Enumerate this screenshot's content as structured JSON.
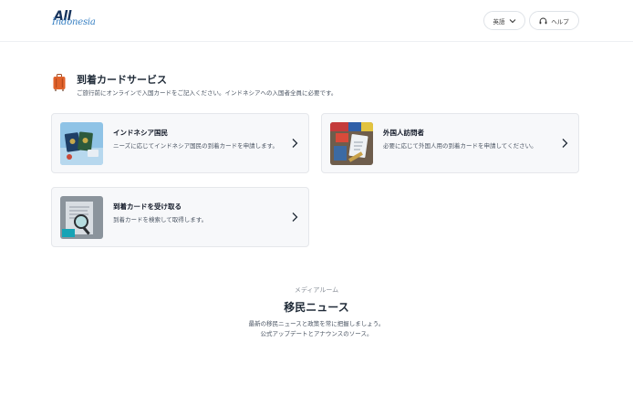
{
  "header": {
    "logo_main": "All",
    "logo_sub": "Indonesia",
    "language_label": "英語",
    "help_label": "ヘルプ"
  },
  "service": {
    "title": "到着カードサービス",
    "subtitle": "ご旅行前にオンラインで入国カードをご記入ください。インドネシアへの入国者全員に必要です。",
    "cards": [
      {
        "title": "インドネシア国民",
        "description": "ニーズに応じてインドネシア国民の到着カードを申請します。"
      },
      {
        "title": "外国人訪問者",
        "description": "必要に応じて外国人用の到着カードを申請してください。"
      },
      {
        "title": "到着カードを受け取る",
        "description": "到着カードを検索して取得します。"
      }
    ]
  },
  "news": {
    "kicker": "メディアルーム",
    "title": "移民ニュース",
    "line1": "最新の移民ニュースと政策を常に把握しましょう。",
    "line2": "公式アップデートとアナウンスのソース。"
  },
  "colors": {
    "brand_dark": "#17335c",
    "brand_light": "#3a82c4",
    "card_bg": "#f7f8fa",
    "luggage_icon": "#e0622b"
  },
  "icons": {
    "language_chevron": "chevron-down-icon",
    "help": "headset-icon",
    "service": "luggage-icon",
    "card_arrow": "chevron-right-icon"
  }
}
